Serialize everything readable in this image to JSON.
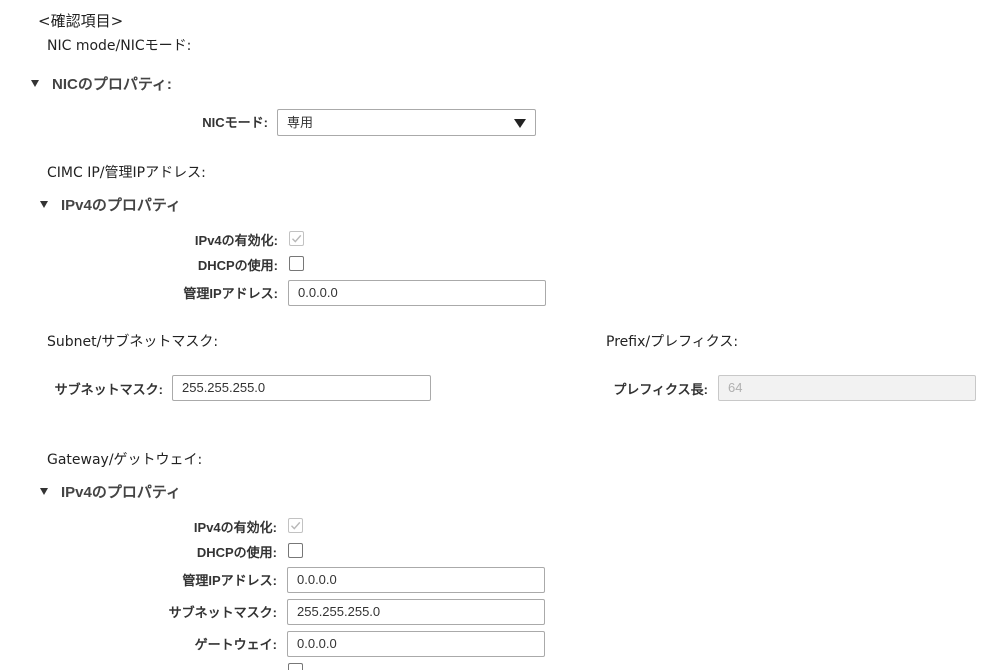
{
  "heading": "<確認項目>",
  "nic_section": {
    "note": "NIC mode/NICモード:",
    "title": "NICのプロパティ:",
    "mode_label": "NICモード:",
    "mode_value": "専用"
  },
  "cimc_section": {
    "note": "CIMC IP/管理IPアドレス:",
    "title": "IPv4のプロパティ",
    "ipv4_enable_label": "IPv4の有効化:",
    "ipv4_enabled": true,
    "dhcp_label": "DHCPの使用:",
    "dhcp_checked": false,
    "mgmt_ip_label": "管理IPアドレス:",
    "mgmt_ip_value": "0.0.0.0"
  },
  "subnet_section": {
    "note": "Subnet/サブネットマスク:",
    "label": "サブネットマスク:",
    "value": "255.255.255.0"
  },
  "prefix_section": {
    "note": "Prefix/プレフィクス:",
    "label": "プレフィクス長:",
    "value": "64"
  },
  "gateway_section": {
    "note": "Gateway/ゲットウェイ:",
    "title": "IPv4のプロパティ",
    "ipv4_enable_label": "IPv4の有効化:",
    "ipv4_enabled": true,
    "dhcp_label": "DHCPの使用:",
    "dhcp_checked": false,
    "mgmt_ip_label": "管理IPアドレス:",
    "mgmt_ip_value": "0.0.0.0",
    "subnet_label": "サブネットマスク:",
    "subnet_value": "255.255.255.0",
    "gateway_label": "ゲートウェイ:",
    "gateway_value": "0.0.0.0"
  },
  "colors": {
    "text": "#222222",
    "section_title": "#444444",
    "field_border": "#aaaaaa",
    "disabled_bg": "#f2f2f2",
    "check_disabled": "#b8b8b8"
  }
}
